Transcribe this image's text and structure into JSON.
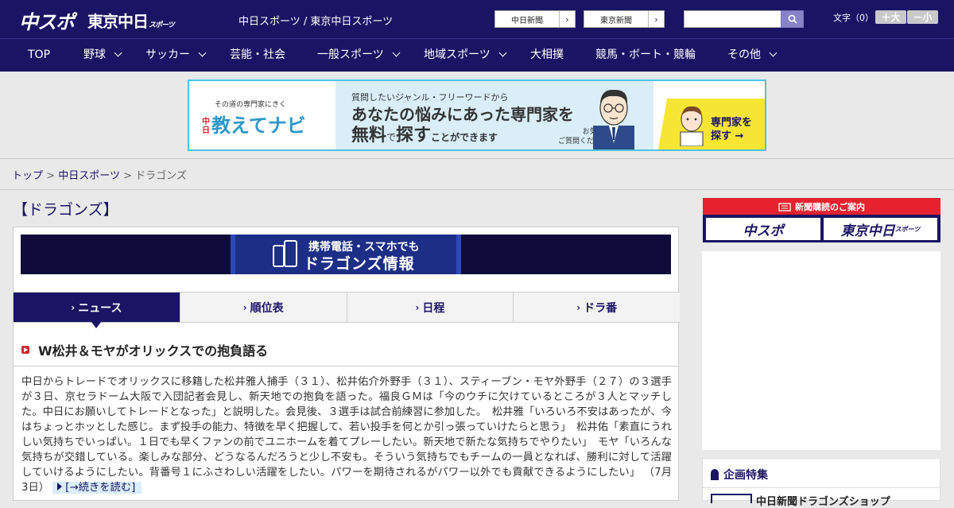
{
  "header": {
    "logo_chuspo": "中スポ",
    "logo_tokyo": "東京中日",
    "logo_tokyo_sub": "スポーツ",
    "tagline": "中日スポーツ / 東京中日スポーツ",
    "paper_buttons": [
      {
        "label": "中日新聞"
      },
      {
        "label": "東京新聞"
      }
    ],
    "search_placeholder": "",
    "font_size_label": "文字（0）",
    "font_larger": "＋大",
    "font_smaller": "－小"
  },
  "nav": {
    "items": [
      {
        "label": "TOP",
        "has_chevron": false
      },
      {
        "label": "野球",
        "has_chevron": true
      },
      {
        "label": "サッカー",
        "has_chevron": true
      },
      {
        "label": "芸能・社会",
        "has_chevron": false
      },
      {
        "label": "一般スポーツ",
        "has_chevron": true
      },
      {
        "label": "地域スポーツ",
        "has_chevron": true
      },
      {
        "label": "大相撲",
        "has_chevron": false
      },
      {
        "label": "競馬・ボート・競輪",
        "has_chevron": false
      },
      {
        "label": "その他",
        "has_chevron": true
      }
    ]
  },
  "ad_banner": {
    "small_text": "その道の専門家にきく",
    "brand_prefix": "中日",
    "brand": "教えてナビ",
    "line1": "質問したいジャンル・フリーワードから",
    "line2": "あなたの悩みにあった専門家を",
    "line3_a": "無料",
    "line3_b": "で",
    "line3_c": "探す",
    "line3_d": "ことができます",
    "note1": "お気軽に",
    "note2": "ご質問ください!",
    "cta1": "専門家を",
    "cta2": "探す →"
  },
  "breadcrumb": {
    "items": [
      "トップ",
      "中日スポーツ"
    ],
    "separator": ">",
    "current": "ドラゴンズ"
  },
  "page_title": "【ドラゴンズ】",
  "mobile_banner": {
    "line1": "携帯電話・スマホでも",
    "line2": "ドラゴンズ情報"
  },
  "tabs": [
    {
      "label": "ニュース",
      "active": true
    },
    {
      "label": "順位表",
      "active": false
    },
    {
      "label": "日程",
      "active": false
    },
    {
      "label": "ドラ番",
      "active": false
    }
  ],
  "article": {
    "headline": "W松井＆モヤがオリックスでの抱負語る",
    "body": "中日からトレードでオリックスに移籍した松井雅人捕手（３１）、松井佑介外野手（３１）、スティーブン・モヤ外野手（２７）の３選手が３日、京セラドーム大阪で入団記者会見し、新天地での抱負を語った。福良ＧＭは「今のウチに欠けているところが３人とマッチした。中日にお願いしてトレードとなった」と説明した。会見後、３選手は試合前練習に参加した。　松井雅「いろいろ不安はあったが、今はちょっとホッとした感じ。まず投手の能力、特徴を早く把握して、若い投手を何とか引っ張っていけたらと思う」　松井佑「素直にうれしい気持ちでいっぱい。１日でも早くファンの前でユニホームを着てプレーしたい。新天地で新たな気持ちでやりたい」　モヤ「いろんな気持ちが交錯している。楽しみな部分、どうなるんだろうと少し不安も。そういう気持ちでもチームの一員となれば、勝利に対して活躍していけるようにしたい。背番号１にふさわしい活躍をしたい。パワーを期待されるがパワー以外でも貢献できるようにしたい」",
    "date": "（7月3日）",
    "readmore": "[→続きを読む]"
  },
  "sidebar": {
    "subscription_head": "新聞購読のご案内",
    "sub_buttons": [
      "中スポ",
      "東京中日"
    ],
    "sub_tokyo_small": "スポーツ",
    "feature_title": "企画特集",
    "feature_item": "中日新聞ドラゴンズショップ"
  },
  "colors": {
    "brand_navy": "#1b1464",
    "accent_red": "#e8212e",
    "ad_cyan": "#4fc3e8",
    "ad_yellow": "#f7e533"
  }
}
